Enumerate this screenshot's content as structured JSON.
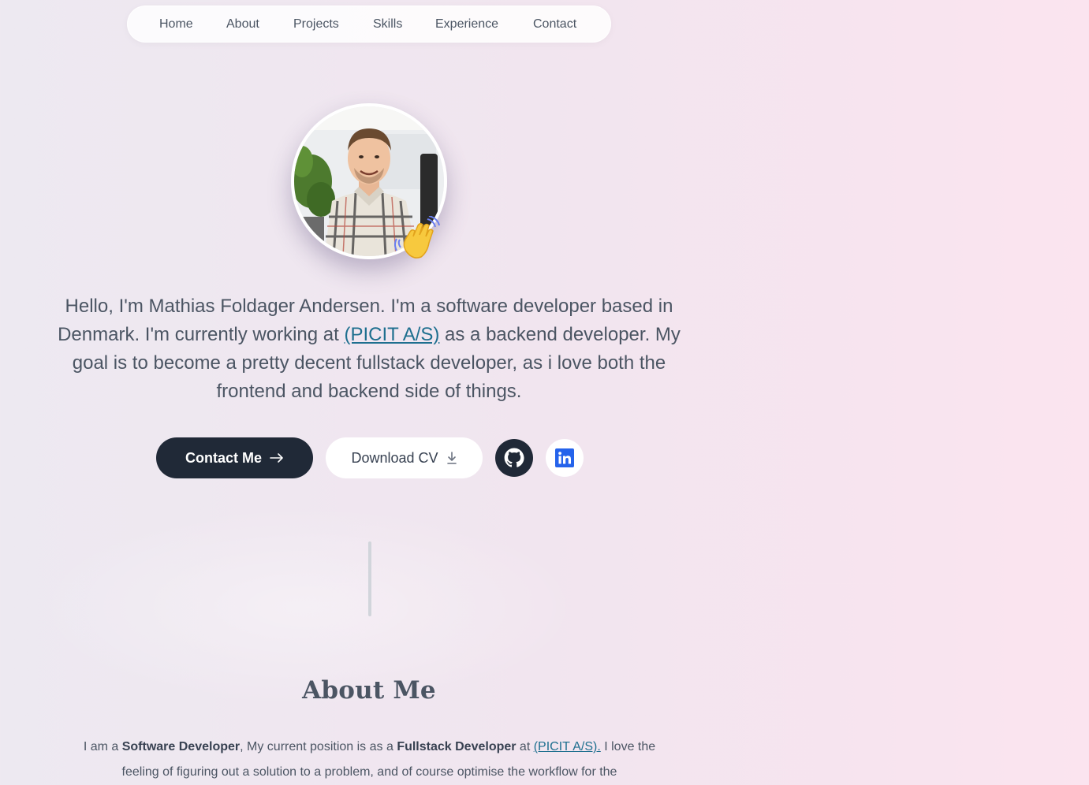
{
  "nav": {
    "items": [
      "Home",
      "About",
      "Projects",
      "Skills",
      "Experience",
      "Contact"
    ]
  },
  "hero": {
    "avatar_alt": "profile-photo",
    "wave_icon": "waving-hand-icon",
    "intro_part1": "Hello, I'm Mathias Foldager Andersen. I'm a software developer based in Denmark. I'm currently working at ",
    "company_link": "(PICIT A/S)",
    "intro_part2": " as a backend developer. My goal is to become a pretty decent fullstack developer, as i love both the frontend and backend side of things."
  },
  "actions": {
    "contact_label": "Contact Me",
    "contact_icon": "arrow-right-icon",
    "cv_label": "Download CV",
    "cv_icon": "download-icon",
    "github_icon": "github-icon",
    "linkedin_icon": "linkedin-icon"
  },
  "about": {
    "title": "About Me",
    "t1": "I am a ",
    "b1": "Software Developer",
    "t2": ", My current position is as a ",
    "b2": "Fullstack Developer",
    "t3": " at ",
    "link": "(PICIT A/S).",
    "t4": " I love the feeling of figuring out a solution to a problem, and of course optimise the workflow for the"
  },
  "colors": {
    "primary_button": "#202937",
    "link": "#1e6f8f",
    "linkedin": "#2563eb"
  }
}
